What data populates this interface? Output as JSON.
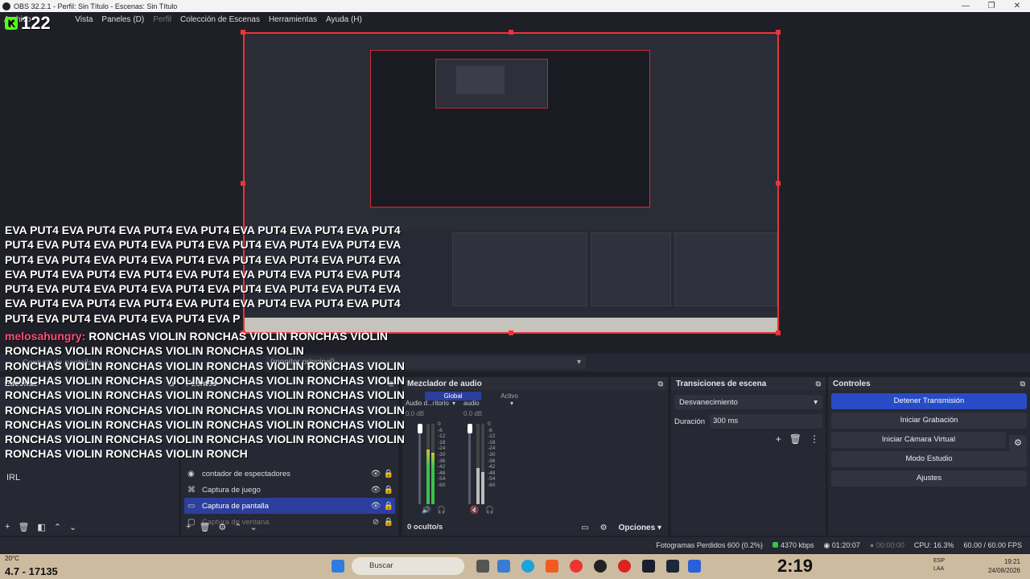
{
  "window": {
    "title": "OBS 32.2.1 - Perfil: Sin Título - Escenas: Sin Título"
  },
  "menu": {
    "items": [
      "Archivo",
      "Vista",
      "Paneles (D)",
      "Perfil",
      "Colección de Escenas",
      "Herramientas",
      "Ayuda (H)"
    ]
  },
  "overlay": {
    "counter": "122",
    "spam_line": "EVA PUT4 EVA PUT4 EVA PUT4 EVA PUT4 EVA PUT4 EVA PUT4 EVA PUT4",
    "spam_lines": [
      "EVA PUT4 EVA PUT4 EVA PUT4 EVA PUT4 EVA PUT4 EVA PUT4 EVA PUT4",
      "PUT4 EVA PUT4 EVA PUT4 EVA PUT4 EVA PUT4 EVA PUT4 EVA PUT4 EVA",
      "PUT4 EVA PUT4 EVA PUT4 EVA PUT4 EVA PUT4 EVA PUT4 EVA PUT4 EVA",
      "EVA PUT4 EVA PUT4 EVA PUT4 EVA PUT4 EVA PUT4 EVA PUT4 EVA PUT4",
      "PUT4 EVA PUT4 EVA PUT4 EVA PUT4 EVA PUT4 EVA PUT4 EVA PUT4 EVA",
      "EVA PUT4 EVA PUT4 EVA PUT4 EVA PUT4 EVA PUT4 EVA PUT4 EVA PUT4",
      "PUT4 EVA PUT4 EVA PUT4 EVA PUT4 EVA P"
    ],
    "chat_user": "melosahungry:",
    "chat_first": "RONCHAS VIOLIN RONCHAS VIOLIN RONCHAS VIOLIN",
    "chat_lines": [
      "RONCHAS VIOLIN RONCHAS VIOLIN RONCHAS VIOLIN",
      "RONCHAS VIOLIN RONCHAS VIOLIN RONCHAS VIOLIN RONCHAS VIOLIN",
      "RONCHAS VIOLIN RONCHAS VIOLIN RONCHAS VIOLIN RONCHAS VIOLIN",
      "RONCHAS VIOLIN RONCHAS VIOLIN RONCHAS VIOLIN RONCHAS VIOLIN",
      "RONCHAS VIOLIN RONCHAS VIOLIN RONCHAS VIOLIN RONCHAS VIOLIN",
      "RONCHAS VIOLIN RONCHAS VIOLIN RONCHAS VIOLIN RONCHAS VIOLIN",
      "RONCHAS VIOLIN RONCHAS VIOLIN RONCHAS VIOLIN RONCHAS VIOLIN",
      "RONCHAS VIOLIN RONCHAS VIOLIN RONCH"
    ]
  },
  "source_bar": {
    "monitor": "Captura de pantalla",
    "display": "(monitor principal)"
  },
  "scenes": {
    "title": "Escenas",
    "items": [
      "IRL"
    ]
  },
  "sources": {
    "title": "Fuentes",
    "items": [
      {
        "icon": "counter-icon",
        "label": "contador de espectadores",
        "active": false,
        "hidden": false
      },
      {
        "icon": "gamepad-icon",
        "label": "Captura de juego",
        "active": false,
        "hidden": false
      },
      {
        "icon": "monitor-icon",
        "label": "Captura de pantalla",
        "active": true,
        "hidden": false
      },
      {
        "icon": "window-icon",
        "label": "Captura de ventana",
        "active": false,
        "hidden": true
      }
    ]
  },
  "mixer": {
    "title": "Mezclador de audio",
    "tab_global": "Global",
    "tab_active": "Activo",
    "channels": [
      {
        "name": "Audio d...ritorio",
        "db": "0.0 dB"
      },
      {
        "name": "audio",
        "db": "0.0 dB"
      }
    ],
    "scale": [
      "0",
      "-6",
      "-12",
      "-18",
      "-24",
      "-30",
      "-36",
      "-42",
      "-48",
      "-54",
      "-60"
    ],
    "hidden_count": "0 oculto/s",
    "options": "Opciones"
  },
  "transitions": {
    "title": "Transiciones de escena",
    "type": "Desvanecimiento",
    "duration_label": "Duración",
    "duration_value": "300 ms"
  },
  "controls": {
    "title": "Controles",
    "stop_stream": "Detener Transmisión",
    "start_record": "Iniciar Grabación",
    "virtual_cam": "Iniciar Cámara Virtual",
    "studio_mode": "Modo Estudio",
    "settings": "Ajustes"
  },
  "status": {
    "dropped_frames": "Fotogramas Perdidos 600 (0.2%)",
    "bitrate": "4370 kbps",
    "stream_time": "01:20:07",
    "record_time": "00:00:00",
    "cpu": "CPU: 16.3%",
    "fps": "60.00 / 60.00 FPS"
  },
  "taskbar": {
    "weather": "20°C",
    "bottom_left": "4.7 - 17135",
    "search": "Buscar",
    "overlay_clock": "2:19",
    "lang": "ESP",
    "lang2": "LAA",
    "time": "19:21",
    "date": "24/08/2026"
  }
}
